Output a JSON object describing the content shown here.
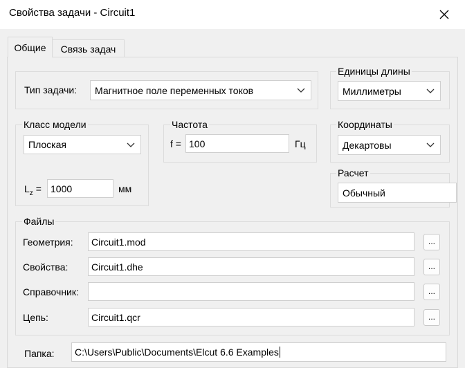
{
  "window": {
    "title": "Свойства задачи - Circuit1",
    "close_glyph": "✕"
  },
  "tabs": [
    {
      "label": "Общие",
      "active": true
    },
    {
      "label": "Связь задач",
      "active": false
    }
  ],
  "problem_type": {
    "label": "Тип задачи:",
    "value": "Магнитное поле переменных токов"
  },
  "units": {
    "group_label": "Единицы длины",
    "value": "Миллиметры"
  },
  "model_class": {
    "group_label": "Класс модели",
    "value": "Плоская",
    "lz_label_main": "L",
    "lz_label_sub": "z",
    "lz_label_eq": "=",
    "lz_value": "1000",
    "lz_unit": "мм"
  },
  "frequency": {
    "group_label": "Частота",
    "f_label": "f =",
    "value": "100",
    "unit": "Гц"
  },
  "coordinates": {
    "group_label": "Координаты",
    "value": "Декартовы"
  },
  "calculation": {
    "group_label": "Расчет",
    "value": "Обычный"
  },
  "files": {
    "group_label": "Файлы",
    "rows": [
      {
        "label": "Геометрия:",
        "value": "Circuit1.mod",
        "browse": "..."
      },
      {
        "label": "Свойства:",
        "value": "Circuit1.dhe",
        "browse": "..."
      },
      {
        "label": "Справочник:",
        "value": "",
        "browse": "..."
      },
      {
        "label": "Цепь:",
        "value": "Circuit1.qcr",
        "browse": "..."
      }
    ]
  },
  "folder": {
    "label": "Папка:",
    "value": "C:\\Users\\Public\\Documents\\Elcut 6.6 Examples"
  }
}
